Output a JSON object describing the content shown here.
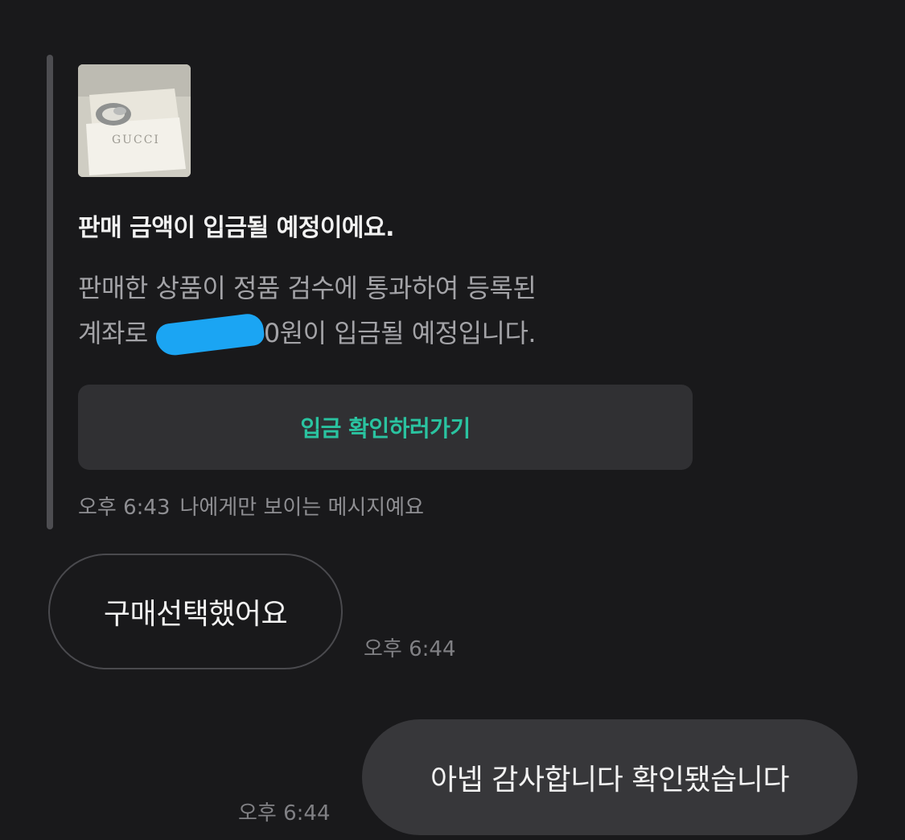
{
  "notice": {
    "thumbnail_brand_text": "GUCCI",
    "title": "판매 금액이 입금될 예정이에요.",
    "body_line1": "판매한 상품이 정품 검수에 통과하여 등록된",
    "body_line2_prefix": "계좌로",
    "body_line2_suffix": "0원이 입금될 예정입니다.",
    "button_label": "입금 확인하러가기",
    "time": "오후 6:43",
    "visibility_note": "나에게만 보이는 메시지예요",
    "button_text_color": "#2ac3a0",
    "redaction_color": "#1ba5f3"
  },
  "messages": [
    {
      "direction": "incoming",
      "text": "구매선택했어요",
      "time": "오후 6:44"
    },
    {
      "direction": "outgoing",
      "text": "아넵 감사합니다 확인됐습니다",
      "time": "오후 6:44"
    }
  ]
}
